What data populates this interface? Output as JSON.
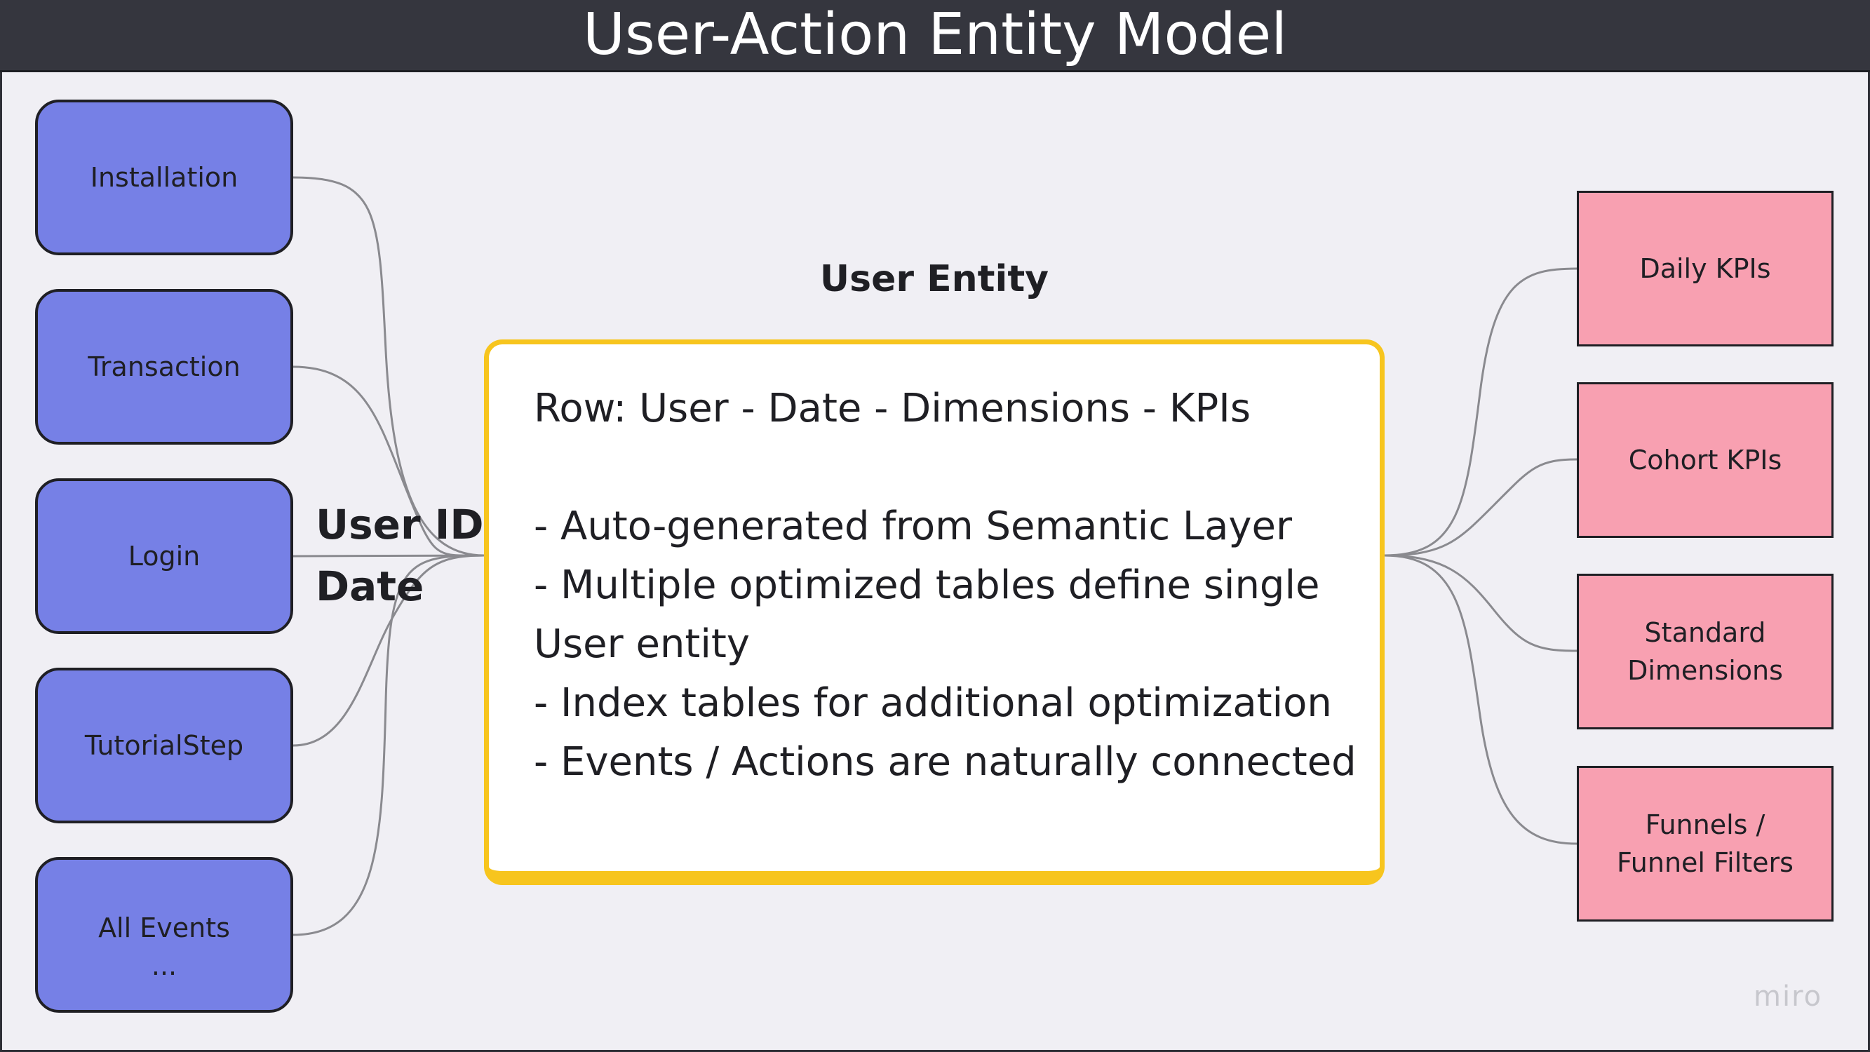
{
  "title": "User-Action Entity Model",
  "events": [
    "Installation",
    "Transaction",
    "Login",
    "TutorialStep",
    "All Events\n..."
  ],
  "keys": [
    "User ID",
    "Date"
  ],
  "entity": {
    "title": "User Entity",
    "body": "Row: User - Date - Dimensions - KPIs\n\n- Auto-generated from Semantic Layer\n- Multiple optimized tables define single User entity\n- Index tables for additional optimization\n- Events / Actions are naturally connected"
  },
  "outputs": [
    "Daily KPIs",
    "Cohort KPIs",
    "Standard\nDimensions",
    "Funnels /\nFunnel Filters"
  ],
  "watermark": "miro",
  "colors": {
    "title_bar": "#35363e",
    "event_fill": "#7680e6",
    "output_fill": "#f8a0b1",
    "entity_border": "#f7c51e",
    "connector": "#8a8a8f"
  }
}
